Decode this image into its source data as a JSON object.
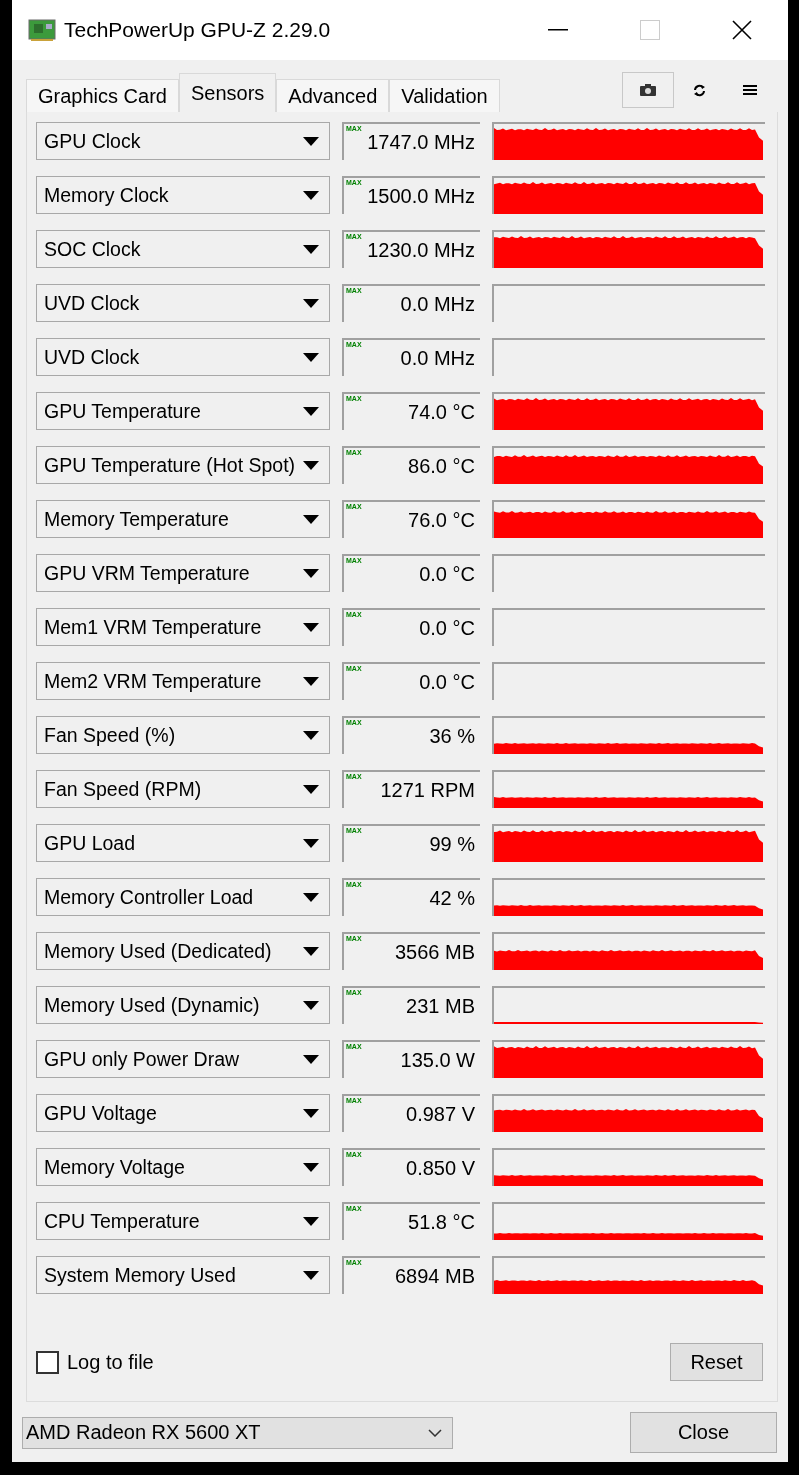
{
  "window": {
    "title": "TechPowerUp GPU-Z 2.29.0"
  },
  "tabs": [
    {
      "label": "Graphics Card",
      "selected": false
    },
    {
      "label": "Sensors",
      "selected": true
    },
    {
      "label": "Advanced",
      "selected": false
    },
    {
      "label": "Validation",
      "selected": false
    }
  ],
  "sensors": [
    {
      "name": "GPU Clock",
      "value": "1747.0 MHz",
      "max_label": "MAX"
    },
    {
      "name": "Memory Clock",
      "value": "1500.0 MHz",
      "max_label": "MAX"
    },
    {
      "name": "SOC Clock",
      "value": "1230.0 MHz",
      "max_label": "MAX"
    },
    {
      "name": "UVD Clock",
      "value": "0.0 MHz",
      "max_label": "MAX"
    },
    {
      "name": "UVD Clock",
      "value": "0.0 MHz",
      "max_label": "MAX"
    },
    {
      "name": "GPU Temperature",
      "value": "74.0 °C",
      "max_label": "MAX"
    },
    {
      "name": "GPU Temperature (Hot Spot)",
      "value": "86.0 °C",
      "max_label": "MAX"
    },
    {
      "name": "Memory Temperature",
      "value": "76.0 °C",
      "max_label": "MAX"
    },
    {
      "name": "GPU VRM Temperature",
      "value": "0.0 °C",
      "max_label": "MAX"
    },
    {
      "name": "Mem1 VRM Temperature",
      "value": "0.0 °C",
      "max_label": "MAX"
    },
    {
      "name": "Mem2 VRM Temperature",
      "value": "0.0 °C",
      "max_label": "MAX"
    },
    {
      "name": "Fan Speed (%)",
      "value": "36 %",
      "max_label": "MAX"
    },
    {
      "name": "Fan Speed (RPM)",
      "value": "1271 RPM",
      "max_label": "MAX"
    },
    {
      "name": "GPU Load",
      "value": "99 %",
      "max_label": "MAX"
    },
    {
      "name": "Memory Controller Load",
      "value": "42 %",
      "max_label": "MAX"
    },
    {
      "name": "Memory Used (Dedicated)",
      "value": "3566 MB",
      "max_label": "MAX"
    },
    {
      "name": "Memory Used (Dynamic)",
      "value": "231 MB",
      "max_label": "MAX"
    },
    {
      "name": "GPU only Power Draw",
      "value": "135.0 W",
      "max_label": "MAX"
    },
    {
      "name": "GPU Voltage",
      "value": "0.987 V",
      "max_label": "MAX"
    },
    {
      "name": "Memory Voltage",
      "value": "0.850 V",
      "max_label": "MAX"
    },
    {
      "name": "CPU Temperature",
      "value": "51.8 °C",
      "max_label": "MAX"
    },
    {
      "name": "System Memory Used",
      "value": "6894 MB",
      "max_label": "MAX"
    }
  ],
  "log_to_file": {
    "label": "Log to file",
    "checked": false
  },
  "reset_button": "Reset",
  "device_select": {
    "value": "AMD Radeon RX 5600 XT"
  },
  "close_button": "Close"
}
